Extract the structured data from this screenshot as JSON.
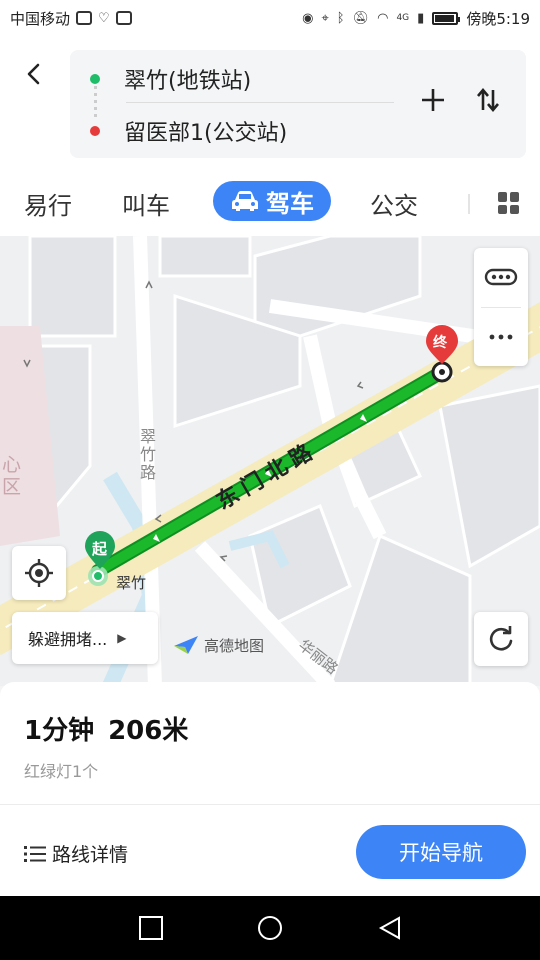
{
  "status_bar": {
    "carrier": "中国移动",
    "network": "4G",
    "time_label": "傍晚5:19"
  },
  "route": {
    "start": "翠竹(地铁站)",
    "end": "留医部1(公交站)",
    "start_color": "#1fbd6a",
    "end_color": "#e63b3b"
  },
  "tabs": {
    "items": [
      "易行",
      "叫车",
      "驾车",
      "公交"
    ],
    "active": "驾车",
    "active_color": "#3d84f7"
  },
  "map": {
    "road_main": "东门北路",
    "road_side": "翠竹路",
    "road_south": "华丽路",
    "district": "心\n区",
    "start_marker": "起",
    "end_marker": "终",
    "start_place": "翠竹",
    "avoid_label": "躲避拥堵...",
    "logo_text": "高德地图",
    "route_color": "#1bb82b"
  },
  "summary": {
    "duration": "1分钟",
    "distance": "206米",
    "traffic_lights": "红绿灯1个"
  },
  "actions": {
    "details_label": "路线详情",
    "navigate_label": "开始导航",
    "navigate_color": "#3d84f7"
  }
}
